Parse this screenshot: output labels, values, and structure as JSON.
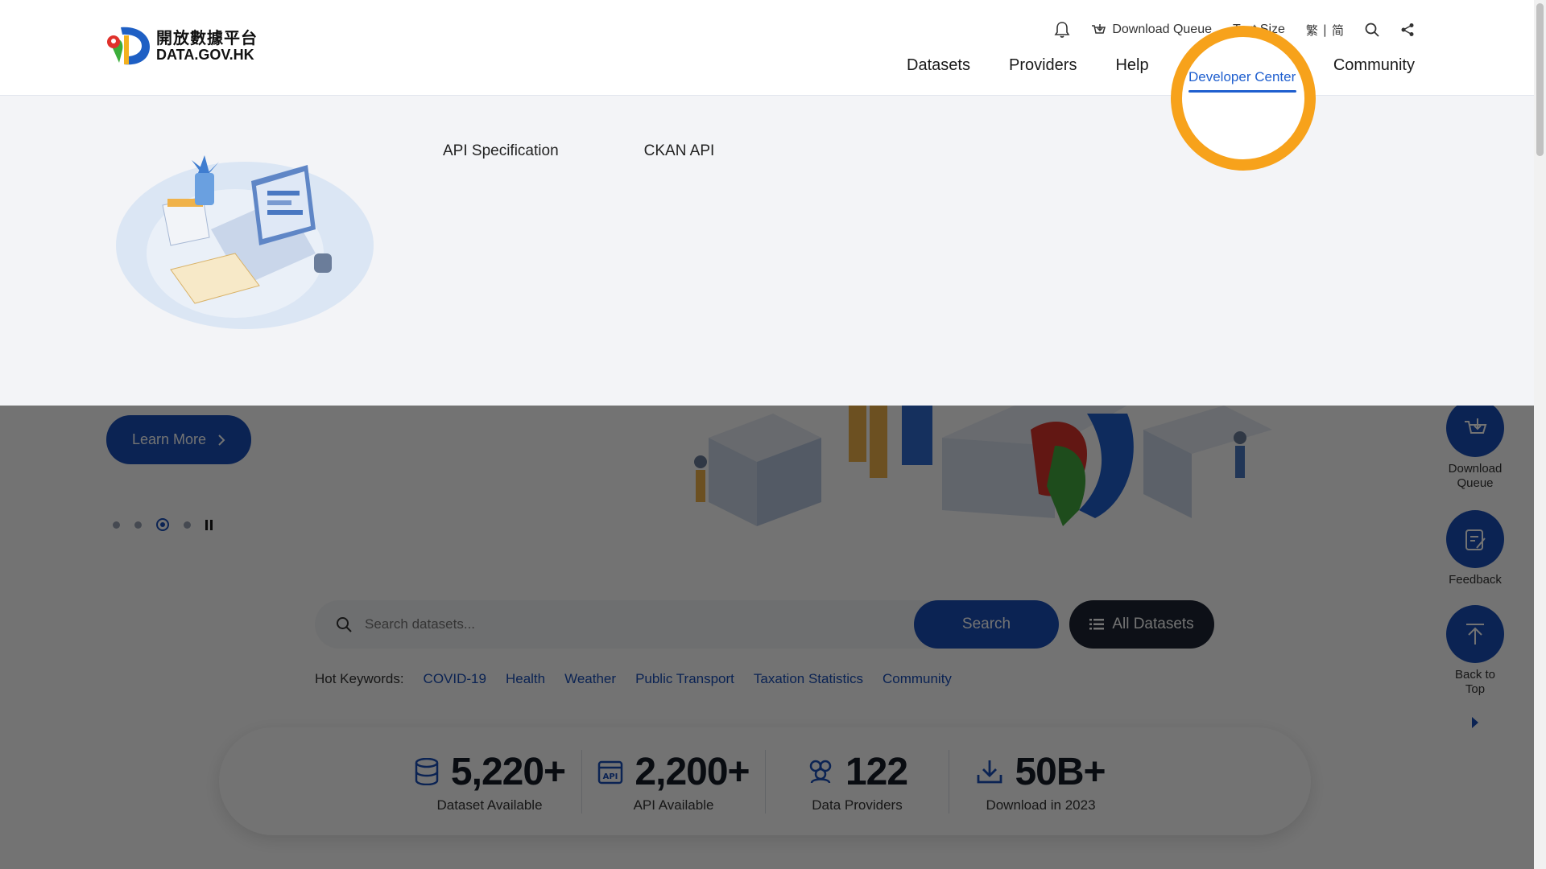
{
  "header": {
    "logo": {
      "cn": "開放數據平台",
      "en": "DATA.GOV.HK"
    },
    "utility": {
      "notifications_icon": "bell-icon",
      "download_queue": "Download Queue",
      "text_size": "Text Size",
      "lang_trad": "繁",
      "lang_sep": "|",
      "lang_simp": "简",
      "search_icon": "search-icon",
      "share_icon": "share-icon"
    },
    "nav": [
      {
        "label": "Datasets"
      },
      {
        "label": "Providers"
      },
      {
        "label": "Help"
      },
      {
        "label": "Developer Center",
        "active": true
      },
      {
        "label": "Community"
      }
    ]
  },
  "megamenu": {
    "links": [
      "API Specification",
      "CKAN API"
    ]
  },
  "hero": {
    "learn_more": "Learn More",
    "carousel": {
      "slides": 4,
      "active": 3
    }
  },
  "search": {
    "placeholder": "Search datasets...",
    "search_button": "Search",
    "all_datasets_button": "All Datasets"
  },
  "hot_keywords": {
    "label": "Hot Keywords:",
    "items": [
      "COVID-19",
      "Health",
      "Weather",
      "Public Transport",
      "Taxation Statistics",
      "Community"
    ]
  },
  "stats": [
    {
      "value": "5,220",
      "suffix": "+",
      "label": "Dataset Available",
      "icon": "database-icon"
    },
    {
      "value": "2,200",
      "suffix": "+",
      "label": "API Available",
      "icon": "api-icon"
    },
    {
      "value": "122",
      "suffix": "",
      "label": "Data Providers",
      "icon": "users-icon"
    },
    {
      "value": "50B",
      "suffix": "+",
      "label": "Download in 2023",
      "icon": "download-icon"
    }
  ],
  "float_tools": {
    "download_queue": "Download Queue",
    "feedback": "Feedback",
    "back_to_top": "Back to Top"
  },
  "colors": {
    "primary": "#1a4fb8",
    "active_nav": "#1f5fcf",
    "highlight_ring": "#f7a21b",
    "dark_button": "#1d2533"
  }
}
